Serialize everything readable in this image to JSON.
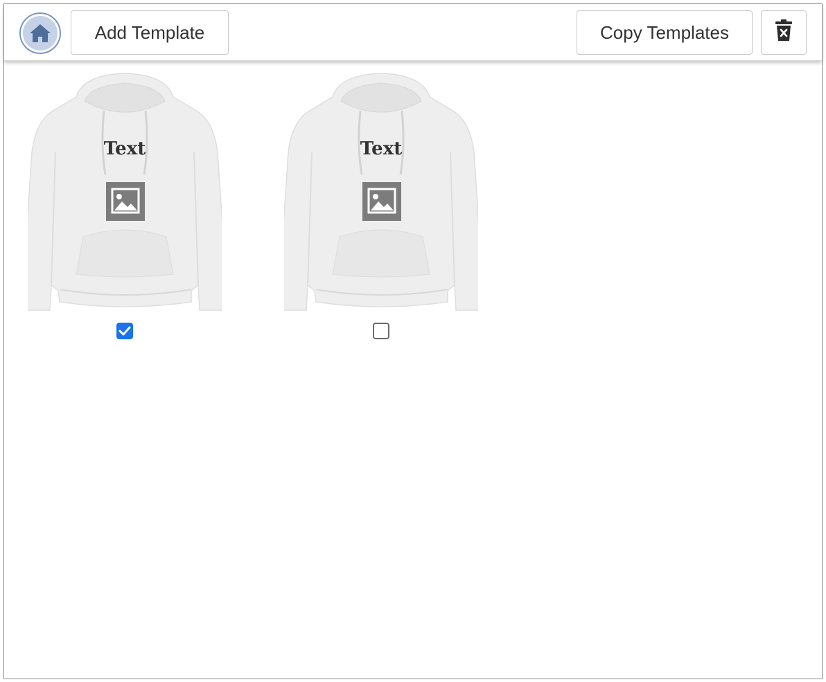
{
  "toolbar": {
    "home_icon": "home-icon",
    "add_label": "Add Template",
    "copy_label": "Copy Templates",
    "delete_icon": "trash-icon"
  },
  "templates": [
    {
      "product": "hoodie",
      "text_label": "Text",
      "image_icon": "image-icon",
      "selected": true
    },
    {
      "product": "hoodie",
      "text_label": "Text",
      "image_icon": "image-icon",
      "selected": false
    }
  ],
  "colors": {
    "accent": "#1a73e8",
    "home_ring": "#7a96bf",
    "home_fill": "#c4d1e6",
    "home_glyph": "#4f6d9a",
    "placeholder": "#7c7c7c"
  }
}
